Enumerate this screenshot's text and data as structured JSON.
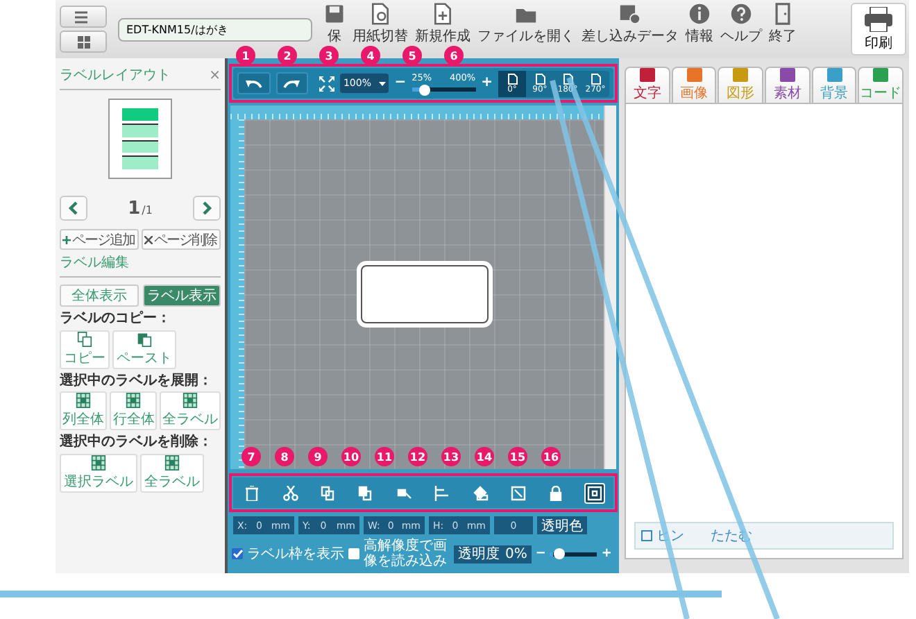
{
  "file_name": "EDT-KNM15/はがき",
  "toolbar": [
    {
      "label": "保",
      "kind": "save"
    },
    {
      "label": "用紙切替",
      "kind": "paper"
    },
    {
      "label": "新規作成",
      "kind": "new"
    },
    {
      "label": "ファイルを開く",
      "kind": "open"
    },
    {
      "label": "差し込みデータ",
      "kind": "data"
    },
    {
      "label": "情報",
      "kind": "info"
    },
    {
      "label": "ヘルプ",
      "kind": "help"
    },
    {
      "label": "終了",
      "kind": "exit"
    }
  ],
  "print_button": "印刷",
  "layout_panel": {
    "title": "ラベルレイアウト",
    "close": "×",
    "page_current": "1",
    "page_total": "/1",
    "add_page": "ページ追加",
    "delete_page": "ページ削除",
    "labels": [
      {
        "selected": true
      },
      {
        "selected": false
      },
      {
        "selected": false
      },
      {
        "selected": false
      }
    ]
  },
  "edit_panel": {
    "title": "ラベル編集",
    "view_buttons": [
      {
        "label": "全体表示",
        "selected": false
      },
      {
        "label": "ラベル表示",
        "selected": true
      }
    ],
    "sections": [
      {
        "heading": "ラベルのコピー：",
        "buttons": [
          {
            "label": "コピー",
            "kind": "copy"
          },
          {
            "label": "ペースト",
            "kind": "paste"
          }
        ]
      },
      {
        "heading": "選択中のラベルを展開：",
        "buttons": [
          {
            "label": "列全体",
            "kind": "grid"
          },
          {
            "label": "行全体",
            "kind": "grid"
          },
          {
            "label": "全ラベル",
            "kind": "grid"
          }
        ]
      },
      {
        "heading": "選択中のラベルを削除：",
        "buttons": [
          {
            "label": "選択ラベル",
            "kind": "grid"
          },
          {
            "label": "全ラベル",
            "kind": "grid"
          }
        ]
      }
    ]
  },
  "canvas_toolbar": {
    "zoom": "100%",
    "zoom_min": "25%",
    "zoom_max": "400%",
    "minus": "−",
    "plus": "+",
    "zoom_slider": {
      "level": 0.15
    },
    "rotations": [
      {
        "label": "0°",
        "selected": true
      },
      {
        "label": "90°",
        "selected": false
      },
      {
        "label": "180°",
        "selected": false
      },
      {
        "label": "270°",
        "selected": false
      }
    ]
  },
  "top_callouts": [
    "1",
    "2",
    "3",
    "4",
    "5",
    "6"
  ],
  "bottom_callouts": [
    "7",
    "8",
    "9",
    "10",
    "11",
    "12",
    "13",
    "14",
    "15",
    "16"
  ],
  "bottom_tools": [
    {
      "kind": "delete",
      "selected": false
    },
    {
      "kind": "cut",
      "selected": false
    },
    {
      "kind": "copy",
      "selected": false
    },
    {
      "kind": "paste",
      "selected": false
    },
    {
      "kind": "select",
      "selected": false
    },
    {
      "kind": "align",
      "selected": false
    },
    {
      "kind": "order",
      "selected": false
    },
    {
      "kind": "fit",
      "selected": false
    },
    {
      "kind": "lock",
      "selected": false
    },
    {
      "kind": "frame",
      "selected": true
    }
  ],
  "properties": {
    "fields": [
      {
        "label": "X:",
        "value": "0",
        "unit": "mm"
      },
      {
        "label": "Y:",
        "value": "0",
        "unit": "mm"
      },
      {
        "label": "W:",
        "value": "0",
        "unit": "mm"
      },
      {
        "label": "H:",
        "value": "0",
        "unit": "mm"
      }
    ],
    "angle": "0",
    "transparent_color": "透明色",
    "show_frame": {
      "label": "ラベル枠を表示",
      "checked": true
    },
    "hi_res": {
      "label": "高解像度で画像を読み込み",
      "checked": false
    },
    "opacity": {
      "label": "透明度",
      "value": "0%",
      "minus": "−",
      "plus": "+",
      "level": 0.08
    }
  },
  "object_tabs": [
    {
      "label": "文字",
      "kind": "text"
    },
    {
      "label": "画像",
      "kind": "image"
    },
    {
      "label": "図形",
      "kind": "shape"
    },
    {
      "label": "素材",
      "kind": "material"
    },
    {
      "label": "背景",
      "kind": "background"
    },
    {
      "label": "コード",
      "kind": "code"
    }
  ],
  "hint": [
    "ヒン",
    "たたむ"
  ]
}
